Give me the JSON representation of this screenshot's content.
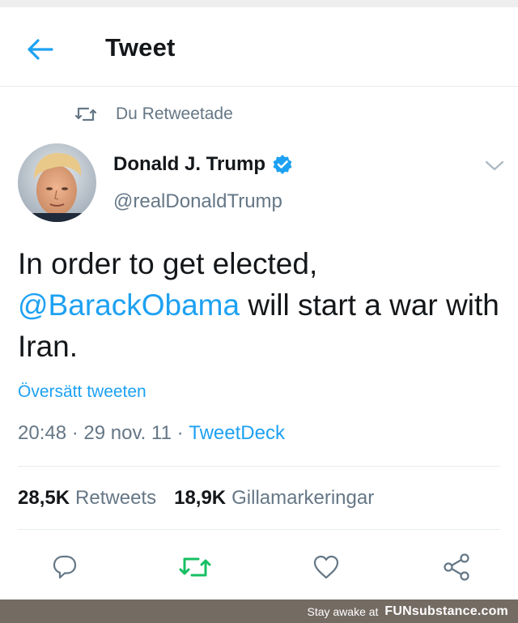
{
  "header": {
    "title": "Tweet",
    "back_icon": "arrow-left-icon"
  },
  "retweet_context": {
    "icon": "retweet-icon",
    "text": "Du Retweetade"
  },
  "author": {
    "name": "Donald J. Trump",
    "handle": "@realDonaldTrump",
    "verified": true,
    "avatar_icon": "avatar-photo"
  },
  "tweet": {
    "text_part1": "In order to get elected,",
    "mention": "@BarackObama",
    "text_part2": " will start a war with Iran.",
    "translate_label": "Översätt tweeten",
    "time": "20:48",
    "date": "29 nov. 11",
    "source": "TweetDeck",
    "separator": " · "
  },
  "stats": {
    "retweets_count": "28,5K",
    "retweets_label": "Retweets",
    "likes_count": "18,9K",
    "likes_label": "Gillamarkeringar"
  },
  "actions": {
    "reply_icon": "reply-icon",
    "retweet_icon": "retweet-icon",
    "like_icon": "heart-icon",
    "share_icon": "share-icon"
  },
  "footer": {
    "text": "Stay awake at",
    "brand": "FUNsubstance.com"
  },
  "colors": {
    "accent": "#1da1f2",
    "retweet_active": "#17bf63",
    "muted": "#657786",
    "footer_bg": "#746b63"
  }
}
